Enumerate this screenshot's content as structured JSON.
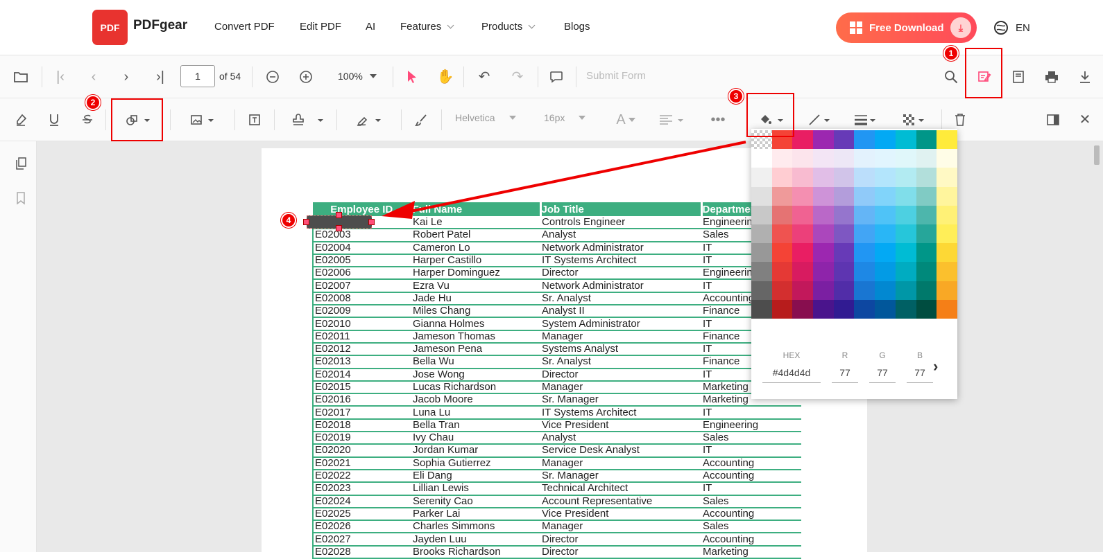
{
  "header": {
    "logo_mark": "PDF",
    "logo_text": "PDFgear",
    "nav": [
      {
        "label": "Convert PDF",
        "has_menu": false
      },
      {
        "label": "Edit PDF",
        "has_menu": false
      },
      {
        "label": "AI",
        "has_menu": false
      },
      {
        "label": "Features",
        "has_menu": true
      },
      {
        "label": "Products",
        "has_menu": true
      },
      {
        "label": "Blogs",
        "has_menu": false
      }
    ],
    "download_label": "Free Download",
    "language": "EN"
  },
  "toolbar_main": {
    "page_number": "1",
    "page_total": "of 54",
    "zoom": "100%",
    "submit_form": "Submit Form"
  },
  "toolbar_edit": {
    "font_family": "Helvetica",
    "font_size": "16px"
  },
  "callouts": [
    "1",
    "2",
    "3",
    "4"
  ],
  "table": {
    "headers": [
      "Employee ID",
      "Full Name",
      "Job Title",
      "Department"
    ],
    "rows": [
      [
        "",
        "Kai Le",
        "Controls Engineer",
        "Engineering"
      ],
      [
        "E02003",
        "Robert Patel",
        "Analyst",
        "Sales"
      ],
      [
        "E02004",
        "Cameron Lo",
        "Network Administrator",
        "IT"
      ],
      [
        "E02005",
        "Harper Castillo",
        "IT Systems Architect",
        "IT"
      ],
      [
        "E02006",
        "Harper Dominguez",
        "Director",
        "Engineering"
      ],
      [
        "E02007",
        "Ezra Vu",
        "Network Administrator",
        "IT"
      ],
      [
        "E02008",
        "Jade Hu",
        "Sr. Analyst",
        "Accounting"
      ],
      [
        "E02009",
        "Miles Chang",
        "Analyst II",
        "Finance"
      ],
      [
        "E02010",
        "Gianna Holmes",
        "System Administrator",
        "IT"
      ],
      [
        "E02011",
        "Jameson Thomas",
        "Manager",
        "Finance"
      ],
      [
        "E02012",
        "Jameson Pena",
        "Systems Analyst",
        "IT"
      ],
      [
        "E02013",
        "Bella Wu",
        "Sr. Analyst",
        "Finance"
      ],
      [
        "E02014",
        "Jose Wong",
        "Director",
        "IT"
      ],
      [
        "E02015",
        "Lucas Richardson",
        "Manager",
        "Marketing"
      ],
      [
        "E02016",
        "Jacob Moore",
        "Sr. Manager",
        "Marketing"
      ],
      [
        "E02017",
        "Luna Lu",
        "IT Systems Architect",
        "IT"
      ],
      [
        "E02018",
        "Bella Tran",
        "Vice President",
        "Engineering"
      ],
      [
        "E02019",
        "Ivy Chau",
        "Analyst",
        "Sales"
      ],
      [
        "E02020",
        "Jordan Kumar",
        "Service Desk Analyst",
        "IT"
      ],
      [
        "E02021",
        "Sophia Gutierrez",
        "Manager",
        "Accounting"
      ],
      [
        "E02022",
        "Eli Dang",
        "Sr. Manager",
        "Accounting"
      ],
      [
        "E02023",
        "Lillian Lewis",
        "Technical Architect",
        "IT"
      ],
      [
        "E02024",
        "Serenity Cao",
        "Account Representative",
        "Sales"
      ],
      [
        "E02025",
        "Parker Lai",
        "Vice President",
        "Accounting"
      ],
      [
        "E02026",
        "Charles Simmons",
        "Manager",
        "Sales"
      ],
      [
        "E02027",
        "Jayden Luu",
        "Director",
        "Accounting"
      ],
      [
        "E02028",
        "Brooks Richardson",
        "Director",
        "Marketing"
      ]
    ]
  },
  "color_picker": {
    "hex_label": "HEX",
    "hex": "#4d4d4d",
    "r_label": "R",
    "r": "77",
    "g_label": "G",
    "g": "77",
    "b_label": "B",
    "b": "77",
    "first_column": [
      "transparent",
      "#ffffff",
      "#f0f0f0",
      "#e0e0e0",
      "#c8c8c8",
      "#b0b0b0",
      "#989898",
      "#808080",
      "#666666",
      "#4d4d4d"
    ],
    "columns": [
      [
        "#f44336",
        "#ffebee",
        "#ffcdd2",
        "#ef9a9a",
        "#e57373",
        "#ef5350",
        "#f44336",
        "#e53935",
        "#d32f2f",
        "#b71c1c"
      ],
      [
        "#e91e63",
        "#fce4ec",
        "#f8bbd0",
        "#f48fb1",
        "#f06292",
        "#ec407a",
        "#e91e63",
        "#d81b60",
        "#c2185b",
        "#880e4f"
      ],
      [
        "#9c27b0",
        "#f3e5f5",
        "#e1bee7",
        "#ce93d8",
        "#ba68c8",
        "#ab47bc",
        "#9c27b0",
        "#8e24aa",
        "#7b1fa2",
        "#4a148c"
      ],
      [
        "#673ab7",
        "#ede7f6",
        "#d1c4e9",
        "#b39ddb",
        "#9575cd",
        "#7e57c2",
        "#673ab7",
        "#5e35b1",
        "#512da8",
        "#311b92"
      ],
      [
        "#2196f3",
        "#e3f2fd",
        "#bbdefb",
        "#90caf9",
        "#64b5f6",
        "#42a5f5",
        "#2196f3",
        "#1e88e5",
        "#1976d2",
        "#0d47a1"
      ],
      [
        "#03a9f4",
        "#e1f5fe",
        "#b3e5fc",
        "#81d4fa",
        "#4fc3f7",
        "#29b6f6",
        "#03a9f4",
        "#039be5",
        "#0288d1",
        "#01579b"
      ],
      [
        "#00bcd4",
        "#e0f7fa",
        "#b2ebf2",
        "#80deea",
        "#4dd0e1",
        "#26c6da",
        "#00bcd4",
        "#00acc1",
        "#0097a7",
        "#006064"
      ],
      [
        "#009688",
        "#e0f2f1",
        "#b2dfdb",
        "#80cbc4",
        "#4db6ac",
        "#26a69a",
        "#009688",
        "#00897b",
        "#00796b",
        "#004d40"
      ],
      [
        "#ffeb3b",
        "#fffde7",
        "#fff9c4",
        "#fff59d",
        "#fff176",
        "#ffee58",
        "#fdd835",
        "#fbc02d",
        "#f9a825",
        "#f57f17"
      ]
    ]
  },
  "colors": {
    "accent": "#ff4a5a",
    "table_header": "#3dae80",
    "callout": "#e00000"
  }
}
